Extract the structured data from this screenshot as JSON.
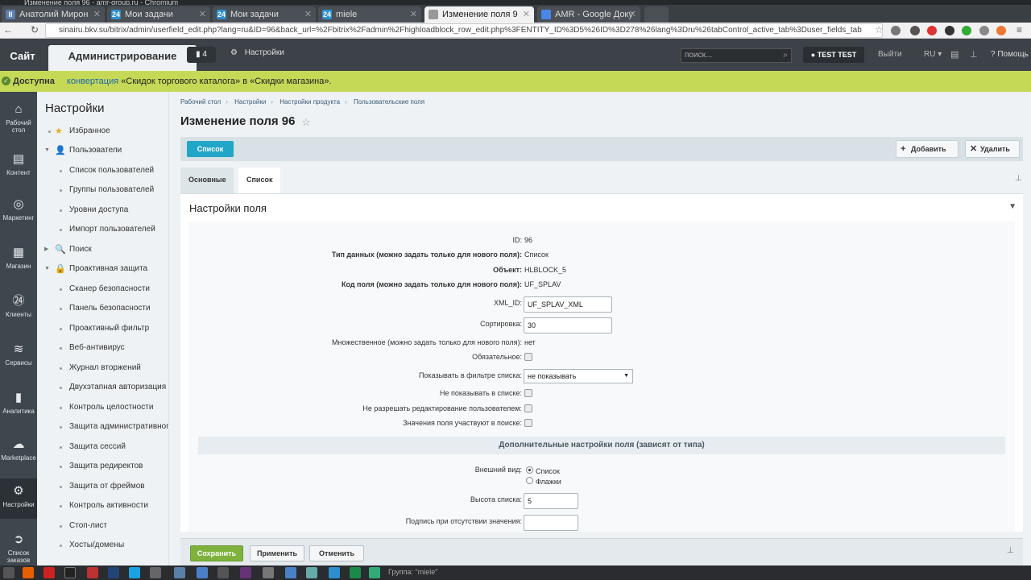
{
  "window_title": "Изменение поля 96 - amr-group.ru - Chromium",
  "browser": {
    "tabs": [
      {
        "label": "Анатолий Мирон",
        "icon_color": "#5b7fb0",
        "active": false
      },
      {
        "label": "Мои задачи",
        "icon_color": "#2d8fd0",
        "active": false
      },
      {
        "label": "Мои задачи",
        "icon_color": "#2d8fd0",
        "active": false
      },
      {
        "label": "miele",
        "icon_color": "#2d8fd0",
        "active": false
      },
      {
        "label": "Изменение поля 9",
        "icon_color": "#999999",
        "active": true
      },
      {
        "label": "AMR - Google Доку",
        "icon_color": "#4a86e8",
        "active": false
      }
    ],
    "tab_icon_text": [
      "II",
      "24",
      "24",
      "24",
      "",
      ""
    ],
    "url": "sinairu.bkv.su/bitrix/admin/userfield_edit.php?lang=ru&ID=96&back_url=%2Fbitrix%2Fadmin%2Fhighloadblock_row_edit.php%3FENTITY_ID%3D5%26ID%3D278%26lang%3Dru%26tabControl_active_tab%3Duser_fields_tab"
  },
  "bx_panel": {
    "site_label": "Сайт",
    "admin_label": "Администрирование",
    "notifications_count": "4",
    "settings_label": "Настройки",
    "search_placeholder": "поиск...",
    "user_label": "TEST TEST",
    "logout_label": "Выйти",
    "lang_label": "RU",
    "help_label": "Помощь"
  },
  "notice": {
    "status": "Доступна",
    "link_text": "конвертация",
    "text": "«Скидок торгового каталога» в «Скидки магазина»."
  },
  "rail": [
    {
      "label": "Рабочий стол",
      "icon": "home-icon",
      "glyph": "⌂"
    },
    {
      "label": "Контент",
      "icon": "document-icon",
      "glyph": "▤"
    },
    {
      "label": "Маркетинг",
      "icon": "target-icon",
      "glyph": "◎"
    },
    {
      "label": "Магазин",
      "icon": "basket-icon",
      "glyph": "▦"
    },
    {
      "label": "Клиенты",
      "icon": "clients-24-icon",
      "glyph": "㉔"
    },
    {
      "label": "Сервисы",
      "icon": "layers-icon",
      "glyph": "≋"
    },
    {
      "label": "Аналитика",
      "icon": "bar-chart-icon",
      "glyph": "▮"
    },
    {
      "label": "Marketplace",
      "icon": "cloud-download-icon",
      "glyph": "☁"
    },
    {
      "label": "Настройки",
      "icon": "gear-icon",
      "glyph": "⚙"
    },
    {
      "label": "Список заказов",
      "icon": "arrow-right-circle-icon",
      "glyph": "➲"
    }
  ],
  "menu": {
    "title": "Настройки",
    "items": [
      {
        "label": "Избранное",
        "type": "section",
        "icon": "star-icon",
        "glyph": "★"
      },
      {
        "label": "Пользователи",
        "type": "section-open",
        "icon": "user-icon",
        "glyph": "👤"
      },
      {
        "label": "Список пользователей",
        "type": "sub"
      },
      {
        "label": "Группы пользователей",
        "type": "sub"
      },
      {
        "label": "Уровни доступа",
        "type": "sub"
      },
      {
        "label": "Импорт пользователей",
        "type": "sub"
      },
      {
        "label": "Поиск",
        "type": "section-closed",
        "icon": "search-icon",
        "glyph": "🔍"
      },
      {
        "label": "Проактивная защита",
        "type": "section-open",
        "icon": "lock-icon",
        "glyph": "🔒"
      },
      {
        "label": "Сканер безопасности",
        "type": "sub"
      },
      {
        "label": "Панель безопасности",
        "type": "sub"
      },
      {
        "label": "Проактивный фильтр",
        "type": "sub"
      },
      {
        "label": "Веб-антивирус",
        "type": "sub"
      },
      {
        "label": "Журнал вторжений",
        "type": "sub"
      },
      {
        "label": "Двухэтапная авторизация",
        "type": "sub"
      },
      {
        "label": "Контроль целостности",
        "type": "sub"
      },
      {
        "label": "Защита административного ра",
        "type": "sub"
      },
      {
        "label": "Защита сессий",
        "type": "sub"
      },
      {
        "label": "Защита редиректов",
        "type": "sub"
      },
      {
        "label": "Защита от фреймов",
        "type": "sub"
      },
      {
        "label": "Контроль активности",
        "type": "sub"
      },
      {
        "label": "Стоп-лист",
        "type": "sub"
      },
      {
        "label": "Хосты/домены",
        "type": "sub"
      }
    ]
  },
  "breadcrumb": [
    "Рабочий стол",
    "Настройки",
    "Настройки продукта",
    "Пользовательские поля"
  ],
  "page_title": "Изменение поля 96",
  "toolbar": {
    "list_label": "Список",
    "add_label": "Добавить",
    "delete_label": "Удалить"
  },
  "form_tabs": [
    "Основные",
    "Список"
  ],
  "panel_title": "Настройки поля",
  "fields": {
    "id": {
      "label": "ID:",
      "value": "96"
    },
    "data_type": {
      "label": "Тип данных (можно задать только для нового поля):",
      "value": "Список"
    },
    "object": {
      "label": "Объект:",
      "value": "HLBLOCK_5"
    },
    "field_code": {
      "label": "Код поля (можно задать только для нового поля):",
      "value": "UF_SPLAV"
    },
    "xml_id": {
      "label": "XML_ID:",
      "value": "UF_SPLAV_XML"
    },
    "sort": {
      "label": "Сортировка:",
      "value": "30"
    },
    "multiple": {
      "label": "Множественное (можно задать только для нового поля):",
      "value": "нет"
    },
    "required": {
      "label": "Обязательное:"
    },
    "show_filter": {
      "label": "Показывать в фильтре списка:",
      "value": "не показывать"
    },
    "hide_in_list": {
      "label": "Не показывать в списке:"
    },
    "no_edit": {
      "label": "Не разрешать редактирование пользователем:"
    },
    "in_search": {
      "label": "Значения поля участвуют в поиске:"
    }
  },
  "extra": {
    "header": "Дополнительные настройки поля (зависят от типа)",
    "display_label": "Внешний вид:",
    "display_options": [
      "Список",
      "Флажки"
    ],
    "list_height_label": "Высота списка:",
    "list_height_value": "5",
    "caption_label": "Подпись при отсутствии значения:",
    "caption_value": ""
  },
  "save_bar": {
    "save_label": "Сохранить",
    "apply_label": "Применить",
    "cancel_label": "Отменить"
  },
  "taskbar": {
    "label": "Группа: \"miele\""
  },
  "colors": {
    "accent_blue": "#21a6c8",
    "save_green": "#7eb23c",
    "notice_bg": "#c5d957",
    "panel_dark": "#3c4248"
  }
}
